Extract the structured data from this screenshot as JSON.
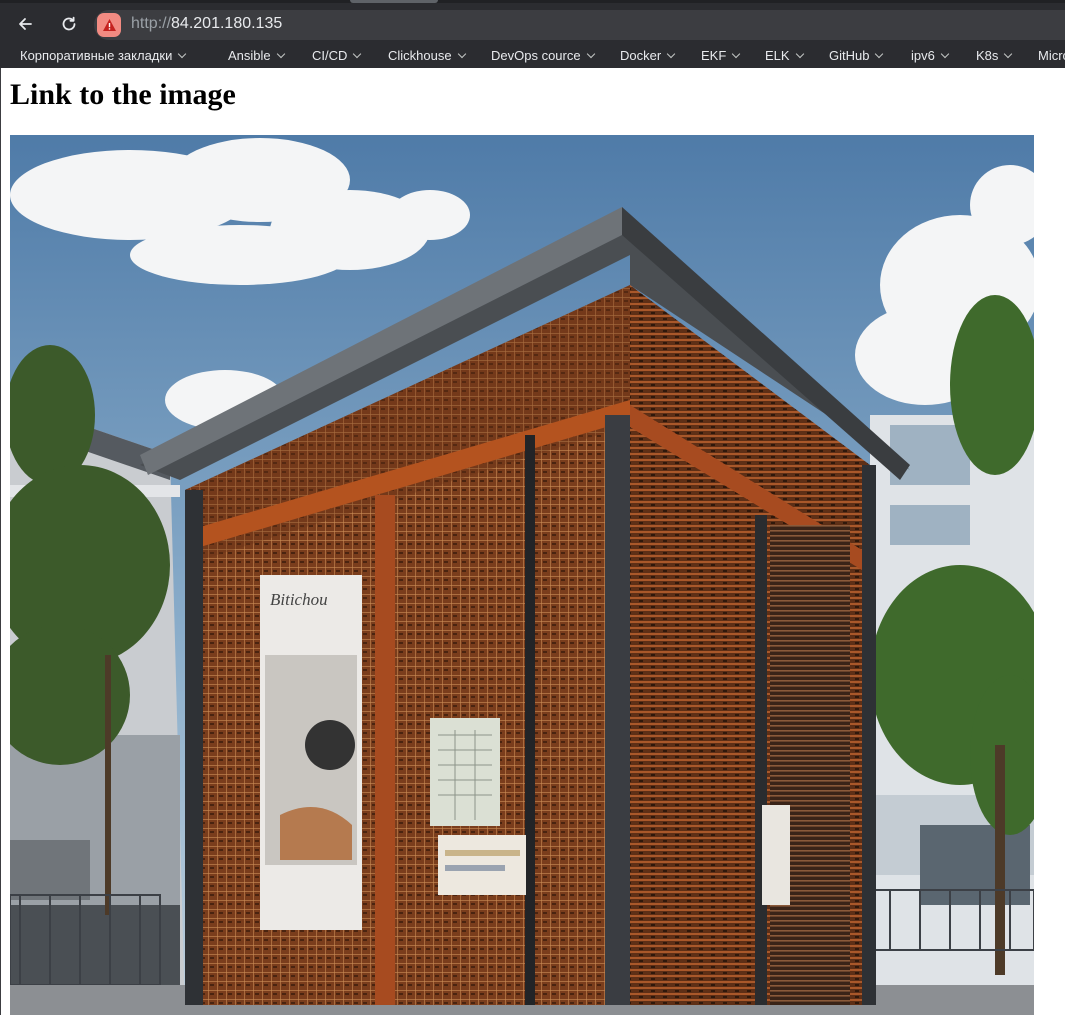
{
  "browser": {
    "url_scheme": "http://",
    "url_host": "84.201.180.135",
    "security_state": "not-secure-warning-icon"
  },
  "bookmarks": [
    {
      "label": "Корпоративные закладки",
      "has_dropdown": true
    },
    {
      "label": "Ansible",
      "has_dropdown": true
    },
    {
      "label": "CI/CD",
      "has_dropdown": true
    },
    {
      "label": "Clickhouse",
      "has_dropdown": true
    },
    {
      "label": "DevOps cource",
      "has_dropdown": true
    },
    {
      "label": "Docker",
      "has_dropdown": true
    },
    {
      "label": "EKF",
      "has_dropdown": true
    },
    {
      "label": "ELK",
      "has_dropdown": true
    },
    {
      "label": "GitHub",
      "has_dropdown": true
    },
    {
      "label": "ipv6",
      "has_dropdown": true
    },
    {
      "label": "K8s",
      "has_dropdown": true
    },
    {
      "label": "Micro",
      "has_dropdown": false
    }
  ],
  "page": {
    "heading": "Link to the image",
    "image_poster_text": "Bitichou"
  },
  "colors": {
    "chrome_bg": "#202124",
    "toolbar_bg": "#2b2c30",
    "urlbar_bg": "#3c3d41",
    "warning": "#f28b82"
  }
}
